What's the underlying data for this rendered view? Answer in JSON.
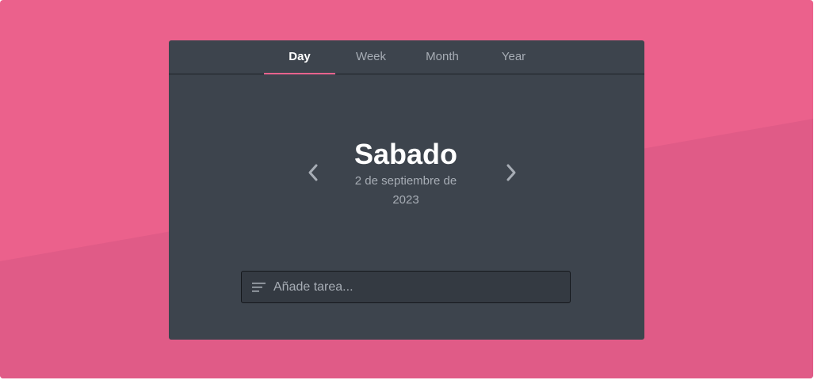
{
  "tabs": [
    {
      "label": "Day",
      "active": true
    },
    {
      "label": "Week",
      "active": false
    },
    {
      "label": "Month",
      "active": false
    },
    {
      "label": "Year",
      "active": false
    }
  ],
  "date_view": {
    "day_name": "Sabado",
    "date_line1": "2 de septiembre de",
    "date_line2": "2023"
  },
  "navigation": {
    "prev_icon": "chevron-left-icon",
    "next_icon": "chevron-right-icon"
  },
  "task_input": {
    "value": "",
    "placeholder": "Añade tarea...",
    "icon": "notes-lines-icon"
  },
  "colors": {
    "background": "#eb618c",
    "background_band": "#e05b87",
    "card": "#3d444d",
    "accent": "#e8638d",
    "input_bg": "#343a42"
  }
}
